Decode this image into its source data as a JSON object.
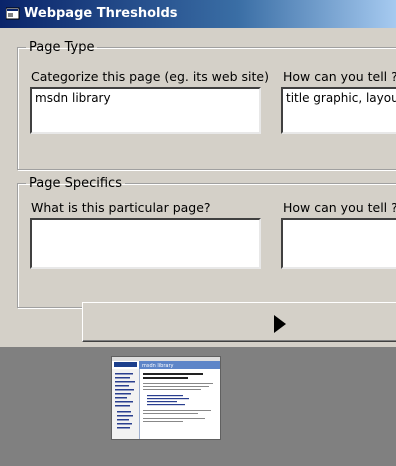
{
  "window": {
    "title": "Webpage Thresholds"
  },
  "page_type": {
    "legend": "Page Type",
    "category_label": "Categorize this page (eg. its web site)",
    "category_value": "msdn library",
    "evidence_label": "How can you tell ?",
    "evidence_value": "title graphic, layout"
  },
  "page_specifics": {
    "legend": "Page Specifics",
    "identity_label": "What is this particular page?",
    "identity_value": "",
    "evidence_label": "How can you tell ?",
    "evidence_value": ""
  },
  "next_button": {
    "icon": "play-arrow-icon"
  },
  "thumbnail": {
    "header_text": "msdn library"
  },
  "colors": {
    "titlebar_start": "#0a246a",
    "titlebar_end": "#a6caf0",
    "dialog_bg": "#d4d0c8",
    "thumb_area_bg": "#808080"
  }
}
